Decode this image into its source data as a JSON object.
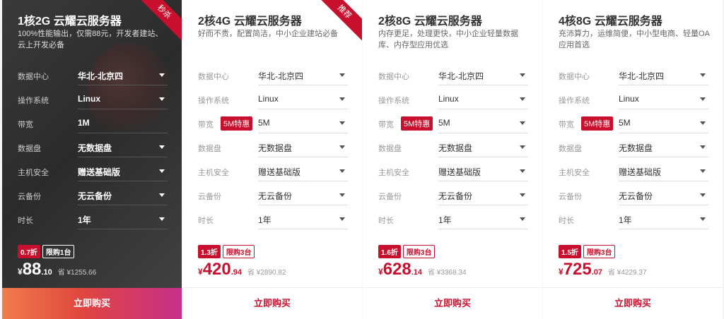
{
  "cards": [
    {
      "title": "1核2G 云耀云服务器",
      "desc": "100%性能输出，仅需88元，开发者建站、云上开发必备",
      "ribbon": "秒杀",
      "fields": [
        {
          "label": "数据中心",
          "value": "华北-北京四"
        },
        {
          "label": "操作系统",
          "value": "Linux"
        },
        {
          "label": "带宽",
          "value": "1M"
        },
        {
          "label": "数据盘",
          "value": "无数据盘"
        },
        {
          "label": "主机安全",
          "value": "赠送基础版"
        },
        {
          "label": "云备份",
          "value": "无云备份"
        },
        {
          "label": "时长",
          "value": "1年"
        }
      ],
      "discount": "0.7折",
      "limit": "限购1台",
      "currency": "¥",
      "price_int": "88",
      "price_dec": ".10",
      "orig": "省 ¥1255.66",
      "buy": "立即购买"
    },
    {
      "title": "2核4G 云耀云服务器",
      "desc": "好而不贵，配置简洁，中小企业建站必备",
      "ribbon": "推荐",
      "fields": [
        {
          "label": "数据中心",
          "value": "华北-北京四"
        },
        {
          "label": "操作系统",
          "value": "Linux"
        },
        {
          "label": "带宽",
          "value": "5M",
          "badge": "5M特惠"
        },
        {
          "label": "数据盘",
          "value": "无数据盘"
        },
        {
          "label": "主机安全",
          "value": "赠送基础版"
        },
        {
          "label": "云备份",
          "value": "无云备份"
        },
        {
          "label": "时长",
          "value": "1年"
        }
      ],
      "discount": "1.3折",
      "limit": "限购3台",
      "currency": "¥",
      "price_int": "420",
      "price_dec": ".94",
      "orig": "省 ¥2890.82",
      "buy": "立即购买"
    },
    {
      "title": "2核8G 云耀云服务器",
      "desc": "内存更足，处理更快，中小企业轻量数据库、内存型应用优选",
      "ribbon": "",
      "fields": [
        {
          "label": "数据中心",
          "value": "华北-北京四"
        },
        {
          "label": "操作系统",
          "value": "Linux"
        },
        {
          "label": "带宽",
          "value": "5M",
          "badge": "5M特惠"
        },
        {
          "label": "数据盘",
          "value": "无数据盘"
        },
        {
          "label": "主机安全",
          "value": "赠送基础版"
        },
        {
          "label": "云备份",
          "value": "无云备份"
        },
        {
          "label": "时长",
          "value": "1年"
        }
      ],
      "discount": "1.6折",
      "limit": "限购3台",
      "currency": "¥",
      "price_int": "628",
      "price_dec": ".14",
      "orig": "省 ¥3368.34",
      "buy": "立即购买"
    },
    {
      "title": "4核8G 云耀云服务器",
      "desc": "充沛算力，运维简便，中小型电商、轻量OA应用首选",
      "ribbon": "",
      "fields": [
        {
          "label": "数据中心",
          "value": "华北-北京四"
        },
        {
          "label": "操作系统",
          "value": "Linux"
        },
        {
          "label": "带宽",
          "value": "5M",
          "badge": "5M特惠"
        },
        {
          "label": "数据盘",
          "value": "无数据盘"
        },
        {
          "label": "主机安全",
          "value": "赠送基础版"
        },
        {
          "label": "云备份",
          "value": "无云备份"
        },
        {
          "label": "时长",
          "value": "1年"
        }
      ],
      "discount": "1.5折",
      "limit": "限购3台",
      "currency": "¥",
      "price_int": "725",
      "price_dec": ".07",
      "orig": "省 ¥4229.37",
      "buy": "立即购买"
    }
  ]
}
